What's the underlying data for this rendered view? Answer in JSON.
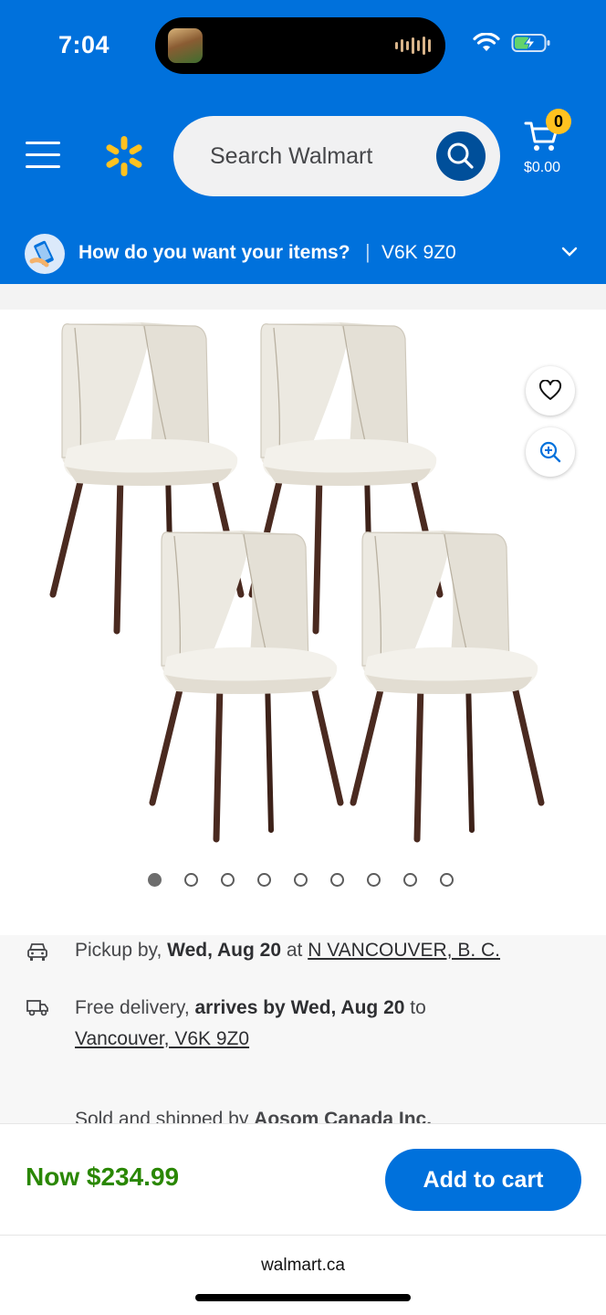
{
  "status_bar": {
    "time": "7:04"
  },
  "header": {
    "search_placeholder": "Search Walmart",
    "cart_count": "0",
    "cart_total": "$0.00"
  },
  "location_bar": {
    "question": "How do you want your items?",
    "separator": "|",
    "postal_code": "V6K 9Z0"
  },
  "gallery": {
    "image_count": 9,
    "active_index": 0
  },
  "fulfillment": {
    "pickup": {
      "prefix": "Pickup by, ",
      "date": "Wed, Aug 20",
      "middle": " at ",
      "store": "N VANCOUVER, B. C."
    },
    "delivery": {
      "prefix": "Free delivery, ",
      "date": "arrives by Wed, Aug 20",
      "middle": " to",
      "destination": "Vancouver, V6K 9Z0"
    },
    "seller": {
      "prefix": "Sold and shipped by ",
      "name": "Aosom Canada Inc."
    }
  },
  "purchase_bar": {
    "price": "Now $234.99",
    "add_to_cart": "Add to cart"
  },
  "browser": {
    "url": "walmart.ca"
  },
  "colors": {
    "brand_blue": "#0071dc",
    "spark_yellow": "#ffc220",
    "price_green": "#2a8703"
  }
}
